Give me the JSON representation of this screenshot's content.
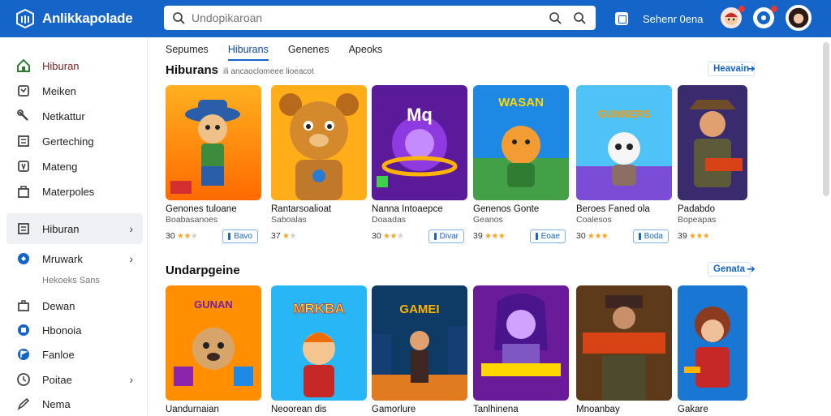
{
  "app": {
    "title": "Anlikkapolade"
  },
  "search": {
    "placeholder": "Undopikaroan"
  },
  "topbar": {
    "user_label": "Sehenr 0ena"
  },
  "sidebar": {
    "items": [
      {
        "label": "Hiburan",
        "icon": "home-icon"
      },
      {
        "label": "Meiken",
        "icon": "puzzle-icon"
      },
      {
        "label": "Netkattur",
        "icon": "wrench-icon"
      },
      {
        "label": "Gerteching",
        "icon": "document-icon"
      },
      {
        "label": "Mateng",
        "icon": "shield-icon"
      },
      {
        "label": "Materpoles",
        "icon": "bag-icon"
      },
      {
        "label": "Hiburan",
        "icon": "list-icon",
        "chevron": "›"
      },
      {
        "label": "Mruwark",
        "icon": "diamond-icon",
        "chevron": "›"
      },
      {
        "label": "Dewan",
        "icon": "briefcase-icon"
      },
      {
        "label": "Hbonoia",
        "icon": "badge-icon"
      },
      {
        "label": "Fanloe",
        "icon": "flag-icon"
      },
      {
        "label": "Poitae",
        "icon": "clock-icon",
        "chevron": "›"
      },
      {
        "label": "Nema",
        "icon": "pen-icon"
      }
    ],
    "sub_label": "Hekoeks Sans"
  },
  "tabs": [
    "Sepumes",
    "Hiburans",
    "Genenes",
    "Apeoks"
  ],
  "sections": [
    {
      "title": "Hiburans",
      "subtitle": "ili ancaoclomeee lioeacot",
      "see_more": "Heavain",
      "cards": [
        {
          "title": "Genones tuloane",
          "sub": "Boabasanoes",
          "rating": "30",
          "stars": 2,
          "button": "Bavo"
        },
        {
          "title": "Rantarsoalioat",
          "sub": "Saboalas",
          "rating": "37",
          "stars": 1,
          "button": ""
        },
        {
          "title": "Nanna Intoaepce",
          "sub": "Doaadas",
          "rating": "30",
          "stars": 3,
          "button": "Divar"
        },
        {
          "title": "Genenos Gonte",
          "sub": "Geanos",
          "rating": "39",
          "stars": 3,
          "button": "Eoae"
        },
        {
          "title": "Beroes Faned ola",
          "sub": "Coalesos",
          "rating": "30",
          "stars": 3,
          "button": "Boda"
        },
        {
          "title": "Padabdo",
          "sub": "Bopeapas",
          "rating": "39",
          "stars": 3,
          "button": ""
        }
      ]
    },
    {
      "title": "Undarpgeine",
      "subtitle": "",
      "see_more": "Genata",
      "cards": [
        {
          "title": "Uandurnaian"
        },
        {
          "title": "Neoorean dis"
        },
        {
          "title": "Gamorlure"
        },
        {
          "title": "Tanlhinena"
        },
        {
          "title": "Mnoanbay"
        },
        {
          "title": "Gakare"
        }
      ]
    }
  ],
  "colors": {
    "topbar": "#1565c8",
    "accent": "#1565c8",
    "star": "#f5a623"
  }
}
